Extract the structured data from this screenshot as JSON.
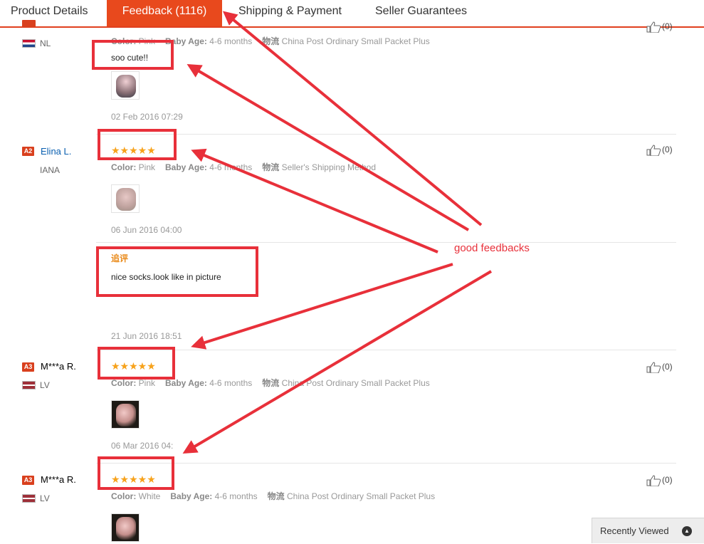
{
  "tabs": {
    "product_details": "Product Details",
    "feedback": "Feedback (1116)",
    "shipping": "Shipping & Payment",
    "seller": "Seller Guarantees"
  },
  "labels": {
    "color": "Color:",
    "baby_age": "Baby Age:",
    "shipping": "物流",
    "additional": "追评",
    "like_count": "(0)"
  },
  "feedback": [
    {
      "country": "NL",
      "color": "Pink",
      "baby_age": "4-6 months",
      "shipping_method": "China Post Ordinary Small Packet Plus",
      "text": "soo cute!!",
      "date": "02 Feb 2016 07:29",
      "likes": "(0)"
    },
    {
      "level": "A2",
      "buyer": "Elina L.",
      "country": "IANA",
      "stars": "★★★★★",
      "color": "Pink",
      "baby_age": "4-6 months",
      "shipping_method": "Seller's Shipping Method",
      "date": "06 Jun 2016 04:00",
      "likes": "(0)",
      "additional_label": "追评",
      "additional_text": "nice socks.look like in picture",
      "additional_date": "21 Jun 2016 18:51"
    },
    {
      "level": "A3",
      "buyer": "M***a R.",
      "country": "LV",
      "stars": "★★★★★",
      "color": "Pink",
      "baby_age": "4-6 months",
      "shipping_method": "China Post Ordinary Small Packet Plus",
      "date": "06 Mar 2016 04:",
      "likes": "(0)"
    },
    {
      "level": "A3",
      "buyer": "M***a R.",
      "country": "LV",
      "stars": "★★★★★",
      "color": "White",
      "baby_age": "4-6 months",
      "shipping_method": "China Post Ordinary Small Packet Plus",
      "likes": "(0)"
    }
  ],
  "annotation": {
    "text": "good feedbacks",
    "color": "#e8303a"
  },
  "recently_viewed": "Recently Viewed",
  "colors": {
    "accent": "#e8491d",
    "star": "#f7a21b",
    "link": "#0a5fb0"
  }
}
